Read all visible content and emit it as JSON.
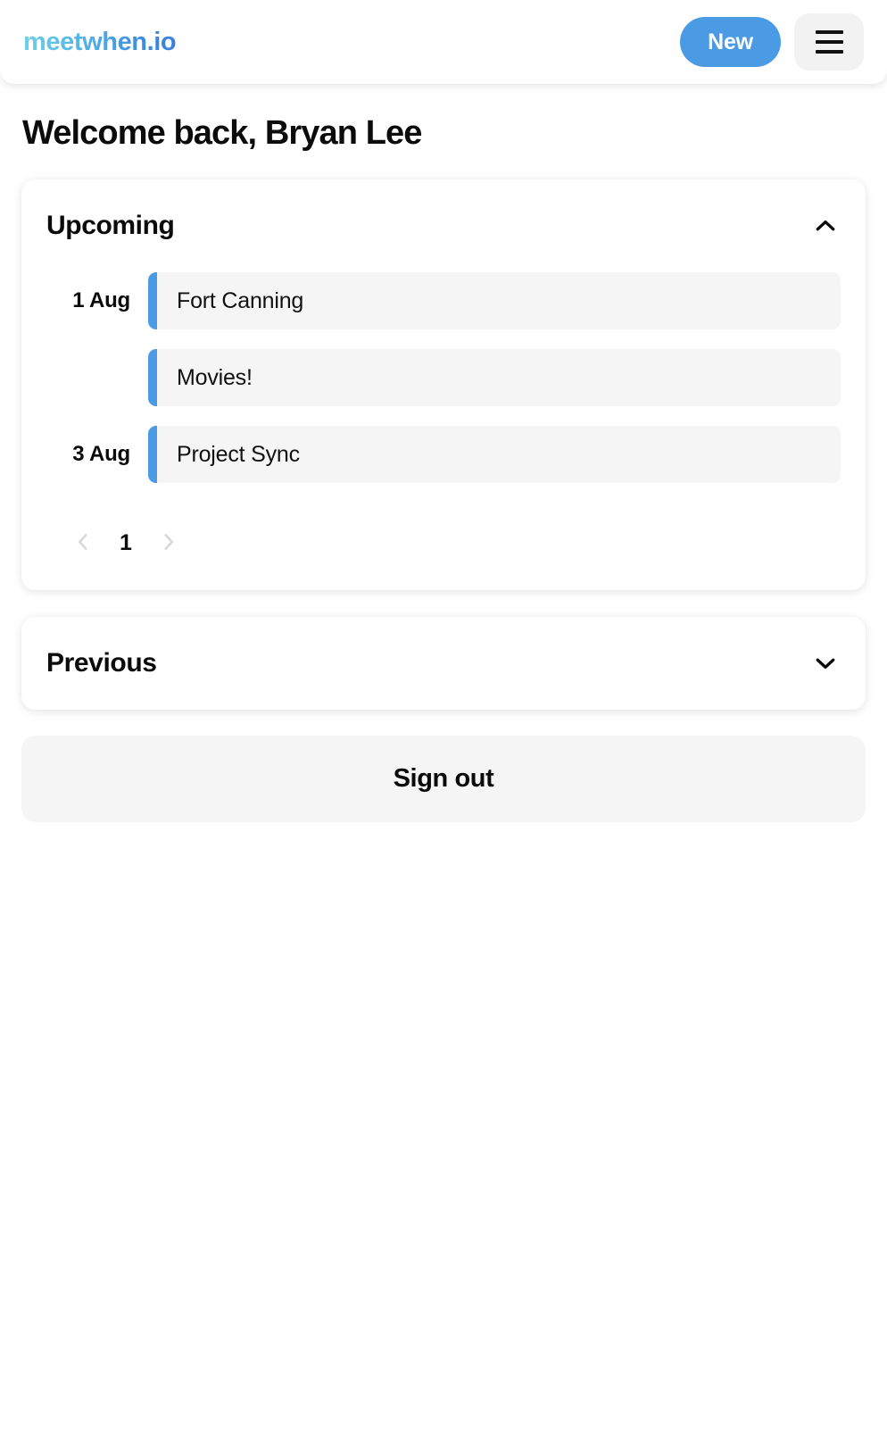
{
  "header": {
    "logo_text": "meetwhen.io",
    "new_button_label": "New",
    "menu_icon": "hamburger-menu-icon"
  },
  "main": {
    "page_title": "Welcome back, Bryan Lee",
    "upcoming": {
      "title": "Upcoming",
      "expanded": true,
      "toggle_icon": "chevron-up-icon",
      "events": [
        {
          "date": "1 Aug",
          "name": "Fort Canning"
        },
        {
          "date": "",
          "name": "Movies!"
        },
        {
          "date": "3 Aug",
          "name": "Project Sync"
        }
      ],
      "pagination": {
        "prev_icon": "chevron-left-icon",
        "next_icon": "chevron-right-icon",
        "current_page": "1",
        "prev_disabled": true,
        "next_disabled": true
      }
    },
    "previous": {
      "title": "Previous",
      "expanded": false,
      "toggle_icon": "chevron-down-icon"
    },
    "sign_out_label": "Sign out"
  },
  "colors": {
    "accent_blue": "#4a9ae4",
    "logo_gradient_start": "#6fd0e8",
    "logo_gradient_end": "#3a7fdc",
    "row_background": "#f5f5f5",
    "menu_background": "#f2f2f3",
    "text_primary": "#0b0b0b",
    "disabled_arrow": "#d8d8d8"
  }
}
